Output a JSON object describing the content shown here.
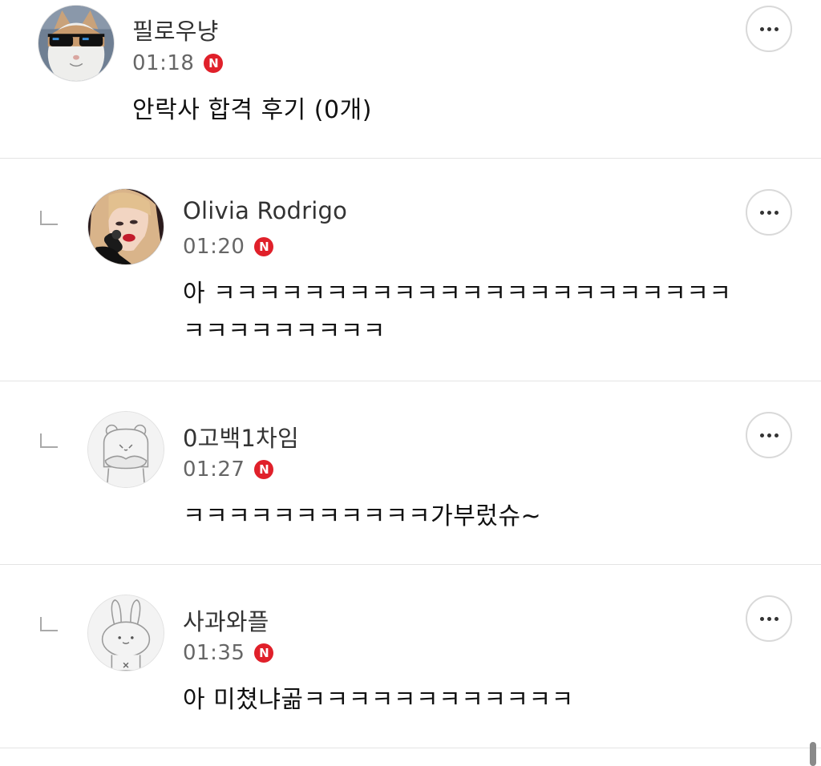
{
  "comments": [
    {
      "author": "필로우냥",
      "time": "01:18",
      "badge": "N",
      "text": "안락사 합격 후기 (0개)",
      "avatar": "cat-sunglasses-avatar",
      "is_reply": false
    },
    {
      "author": "Olivia Rodrigo",
      "time": "01:20",
      "badge": "N",
      "text": "아 ㅋㅋㅋㅋㅋㅋㅋㅋㅋㅋㅋㅋㅋㅋㅋㅋㅋㅋㅋㅋㅋㅋㅋ\nㅋㅋㅋㅋㅋㅋㅋㅋㅋ",
      "avatar": "singer-photo-avatar",
      "is_reply": true
    },
    {
      "author": "0고백1차임",
      "time": "01:27",
      "badge": "N",
      "text": "ㅋㅋㅋㅋㅋㅋㅋㅋㅋㅋㅋ가부렀슈~",
      "avatar": "default-bear-avatar",
      "is_reply": true
    },
    {
      "author": "사과와플",
      "time": "01:35",
      "badge": "N",
      "text": "아 미쳤냐곪ㅋㅋㅋㅋㅋㅋㅋㅋㅋㅋㅋㅋ",
      "avatar": "default-rabbit-avatar",
      "is_reply": true
    }
  ],
  "icons": {
    "more": "more-options-icon",
    "reply": "reply-indent-icon",
    "new_badge": "new-badge-icon"
  },
  "colors": {
    "badge": "#e0202a",
    "divider": "#e4e4e4",
    "time": "#666666"
  }
}
